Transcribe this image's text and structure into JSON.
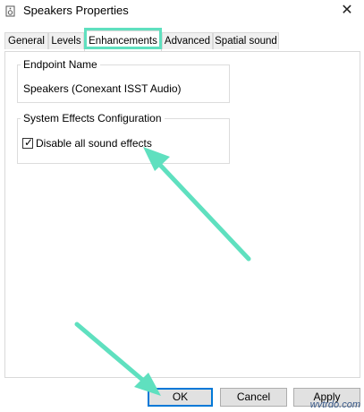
{
  "window": {
    "title": "Speakers Properties",
    "close_glyph": "✕"
  },
  "tabs": [
    {
      "label": "General",
      "selected": false
    },
    {
      "label": "Levels",
      "selected": false
    },
    {
      "label": "Enhancements",
      "selected": true
    },
    {
      "label": "Advanced",
      "selected": false
    },
    {
      "label": "Spatial sound",
      "selected": false
    }
  ],
  "endpoint": {
    "group_label": "Endpoint Name",
    "value": "Speakers (Conexant ISST Audio)"
  },
  "system_effects": {
    "group_label": "System Effects Configuration",
    "checkbox_label": "Disable all sound effects",
    "checked": true
  },
  "buttons": {
    "ok": "OK",
    "cancel": "Cancel",
    "apply": "Apply"
  },
  "watermark": "wvtrdo.com",
  "colors": {
    "annotation_accent": "#5fe0bf",
    "default_button_border": "#0078d7"
  },
  "icons": [
    "speaker-icon",
    "close-icon",
    "checkmark-icon",
    "annotation-arrow-icon"
  ]
}
